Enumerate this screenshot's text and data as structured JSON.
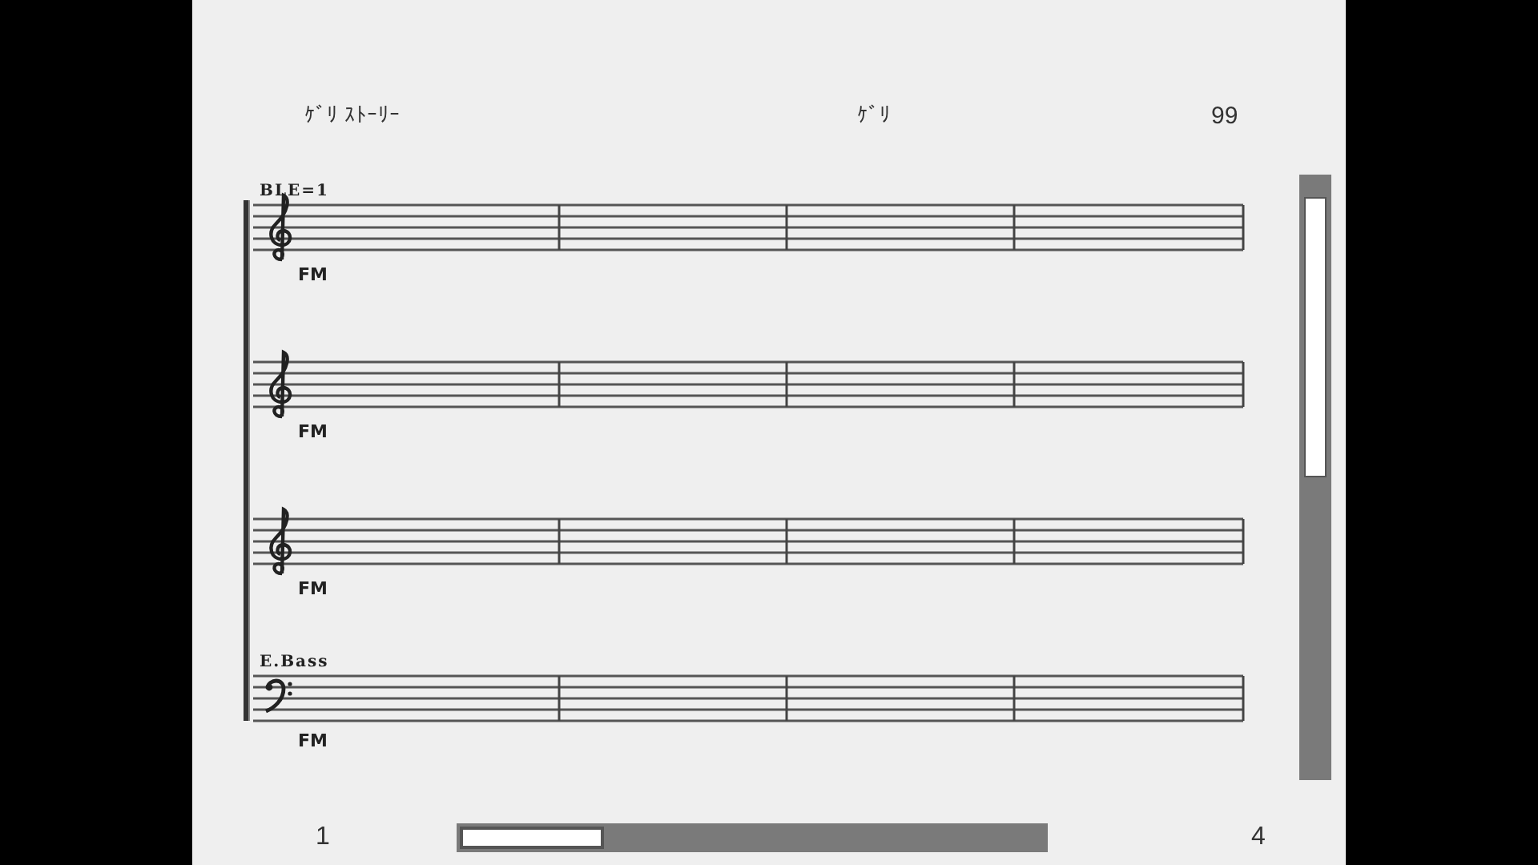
{
  "header": {
    "title": "ｹﾞﾘ ｽﾄｰﾘｰ",
    "composer": "ｹﾞﾘ",
    "number": "99"
  },
  "staves": [
    {
      "name": "BLE=1",
      "kind": "treble",
      "sound": "FM"
    },
    {
      "kind": "treble",
      "sound": "FM"
    },
    {
      "kind": "treble",
      "sound": "FM"
    },
    {
      "name": "E.Bass",
      "kind": "bass",
      "sound": "FM"
    }
  ],
  "pager": {
    "first": "1",
    "last": "4"
  }
}
